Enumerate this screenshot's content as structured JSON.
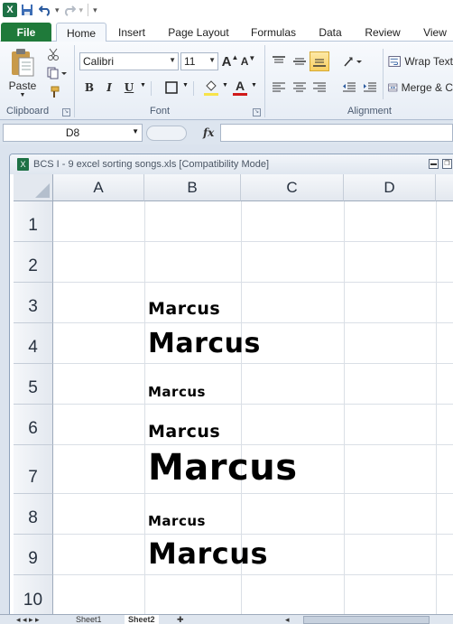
{
  "qat": {
    "undo_arrow": "▾",
    "redo_arrow": "▾",
    "customize": "▾"
  },
  "tabs": {
    "file": "File",
    "home": "Home",
    "insert": "Insert",
    "page_layout": "Page Layout",
    "formulas": "Formulas",
    "data": "Data",
    "review": "Review",
    "view": "View"
  },
  "ribbon": {
    "clipboard": {
      "paste": "Paste",
      "label": "Clipboard"
    },
    "font": {
      "font_name": "Calibri",
      "font_size": "11",
      "grow": "A",
      "shrink": "A",
      "bold": "B",
      "italic": "I",
      "underline": "U",
      "font_color_glyph": "A",
      "label": "Font"
    },
    "alignment": {
      "wrap_text": "Wrap Text",
      "merge": "Merge & C",
      "label": "Alignment"
    }
  },
  "formula_bar": {
    "name_box": "D8",
    "fx": "fx",
    "value": ""
  },
  "workbook": {
    "title": "BCS I - 9 excel sorting songs.xls  [Compatibility Mode]",
    "columns": [
      "A",
      "B",
      "C",
      "D"
    ],
    "rows": [
      "1",
      "2",
      "3",
      "4",
      "5",
      "6",
      "7",
      "8",
      "9",
      "10"
    ],
    "cells": {
      "B3": "Marcus",
      "B4": "Marcus",
      "B5": "Marcus",
      "B6": "Marcus",
      "B7": "Marcus",
      "B8": "Marcus",
      "B9": "Marcus"
    }
  },
  "sheet_tabs": {
    "sheet1": "Sheet1",
    "sheet2": "Sheet2"
  },
  "colors": {
    "file_tab": "#1f7a3a",
    "ribbon_bg": "#e7edf5",
    "header_bg": "#e3e8ef",
    "highlight": "#f8cf60",
    "font_color_bar": "#d01a1a"
  }
}
